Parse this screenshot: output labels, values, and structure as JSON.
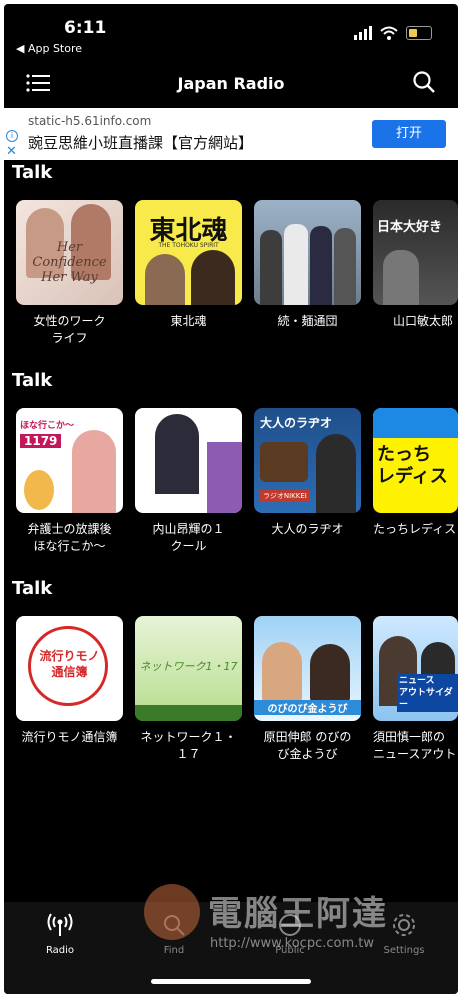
{
  "status": {
    "time": "6:11",
    "back": "◀ App Store"
  },
  "nav": {
    "title": "Japan Radio"
  },
  "ad": {
    "url": "static-h5.61info.com",
    "text": "豌豆思維小班直播課【官方網站】",
    "button": "打开"
  },
  "sections": [
    {
      "title": "Talk",
      "items": [
        {
          "name": "女性のワーク\nライフ"
        },
        {
          "name": "東北魂"
        },
        {
          "name": "続・麺通団"
        },
        {
          "name": "山口敏太郎"
        }
      ]
    },
    {
      "title": "Talk",
      "items": [
        {
          "name": "弁護士の放課後\nほな行こか〜"
        },
        {
          "name": "内山昂輝の１\nクール"
        },
        {
          "name": "大人のラヂオ"
        },
        {
          "name": "たっちレディス"
        }
      ]
    },
    {
      "title": "Talk",
      "items": [
        {
          "name": "流行りモノ通信簿"
        },
        {
          "name": "ネットワーク１・\n１７"
        },
        {
          "name": "原田伸郎 のびの\nび金ようび"
        },
        {
          "name": "須田慎一郎の\nニュースアウト"
        }
      ]
    }
  ],
  "thumbs": {
    "t1_text": "Her Confidence Her Way",
    "t2_text": "東北魂",
    "t2_sub": "THE TOHOKU SPIRIT",
    "t4_text": "日本大好き",
    "t5_text": "ほな行こか〜",
    "t5_sub": "1179",
    "t7_text": "大人のラヂオ",
    "t7_sub": "ラジオNIKKEI",
    "t8_text": "たっち\nレディス",
    "t9_text": "流行りモノ\n通信簿",
    "t10_text": "ネットワーク1・17",
    "t11_text": "のびのび金ようび",
    "t12_text": "ニュース\nアウトサイダー"
  },
  "tabs": [
    {
      "label": "Radio"
    },
    {
      "label": "Find"
    },
    {
      "label": "Public"
    },
    {
      "label": "Settings"
    }
  ],
  "watermark": {
    "text": "電腦王阿達",
    "url": "http://www.kocpc.com.tw"
  }
}
